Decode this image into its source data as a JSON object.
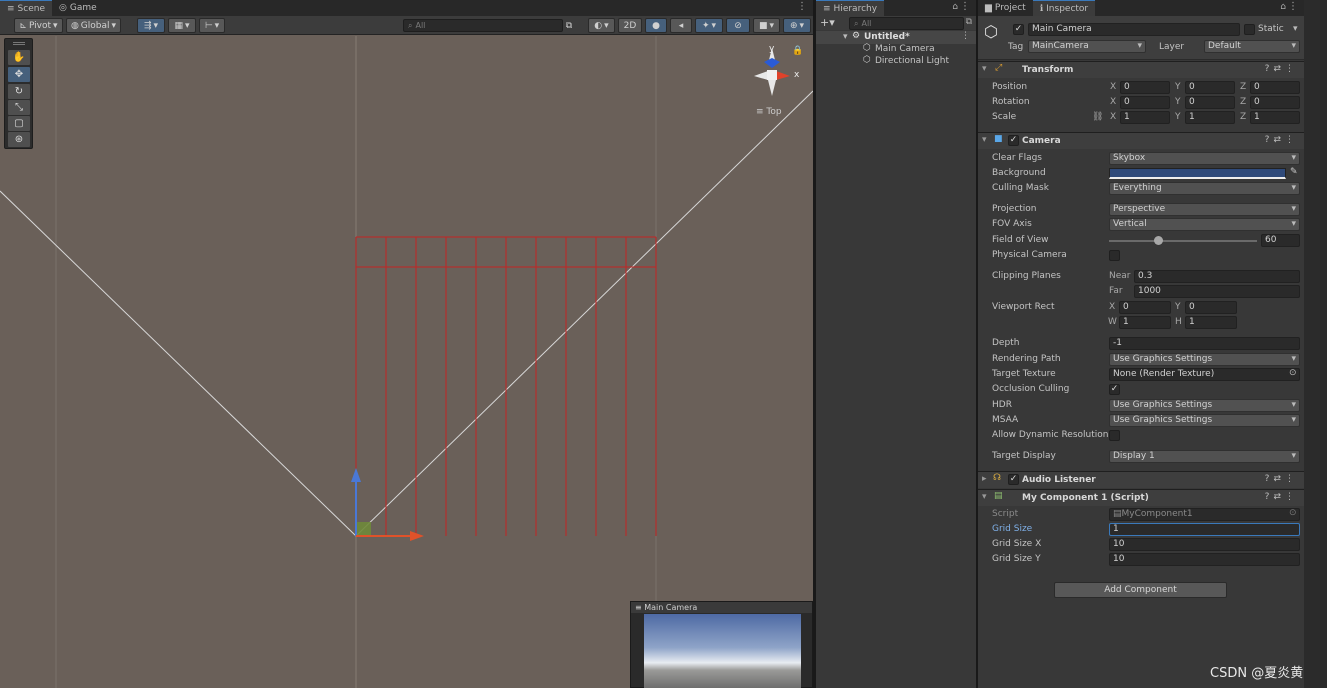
{
  "scene": {
    "tabs": [
      "Scene",
      "Game"
    ],
    "pivot": "Pivot",
    "global": "Global",
    "search_placeholder": "All",
    "btn_2d": "2D",
    "gizmo_label": "Top",
    "gizmo_x": "x",
    "gizmo_y": "y",
    "preview_title": "Main Camera"
  },
  "hierarchy": {
    "tab": "Hierarchy",
    "search_placeholder": "All",
    "scene_name": "Untitled*",
    "items": [
      "Main Camera",
      "Directional Light"
    ]
  },
  "inspector": {
    "tabs": [
      "Project",
      "Inspector"
    ],
    "object_name": "Main Camera",
    "static_label": "Static",
    "tag_label": "Tag",
    "tag_value": "MainCamera",
    "layer_label": "Layer",
    "layer_value": "Default",
    "transform": {
      "title": "Transform",
      "position_label": "Position",
      "rotation_label": "Rotation",
      "scale_label": "Scale",
      "position": [
        "0",
        "0",
        "0"
      ],
      "rotation": [
        "0",
        "0",
        "0"
      ],
      "scale": [
        "1",
        "1",
        "1"
      ]
    },
    "camera": {
      "title": "Camera",
      "clear_flags_label": "Clear Flags",
      "clear_flags": "Skybox",
      "background_label": "Background",
      "background_color": "#2f4a7a",
      "culling_mask_label": "Culling Mask",
      "culling_mask": "Everything",
      "projection_label": "Projection",
      "projection": "Perspective",
      "fov_axis_label": "FOV Axis",
      "fov_axis": "Vertical",
      "fov_label": "Field of View",
      "fov": "60",
      "fov_fraction": 0.33,
      "physical_camera_label": "Physical Camera",
      "clipping_label": "Clipping Planes",
      "near_label": "Near",
      "near": "0.3",
      "far_label": "Far",
      "far": "1000",
      "viewport_label": "Viewport Rect",
      "vx": "0",
      "vy": "0",
      "vw": "1",
      "vh": "1",
      "depth_label": "Depth",
      "depth": "-1",
      "rendering_path_label": "Rendering Path",
      "rendering_path": "Use Graphics Settings",
      "target_texture_label": "Target Texture",
      "target_texture": "None (Render Texture)",
      "occlusion_label": "Occlusion Culling",
      "hdr_label": "HDR",
      "hdr": "Use Graphics Settings",
      "msaa_label": "MSAA",
      "msaa": "Use Graphics Settings",
      "dynres_label": "Allow Dynamic Resolution",
      "target_display_label": "Target Display",
      "target_display": "Display 1"
    },
    "audio_listener": {
      "title": "Audio Listener"
    },
    "my_component": {
      "title": "My Component 1 (Script)",
      "script_label": "Script",
      "script_value": "MyComponent1",
      "grid_size_label": "Grid Size",
      "grid_size": "1",
      "grid_size_x_label": "Grid Size X",
      "grid_size_x": "10",
      "grid_size_y_label": "Grid Size Y",
      "grid_size_y": "10"
    },
    "add_component": "Add Component"
  },
  "watermark": "CSDN @夏炎黄",
  "colors": {
    "grid_red": "#c42424",
    "accent_blue": "#3a79bb",
    "scene_bg": "#6a6059"
  }
}
